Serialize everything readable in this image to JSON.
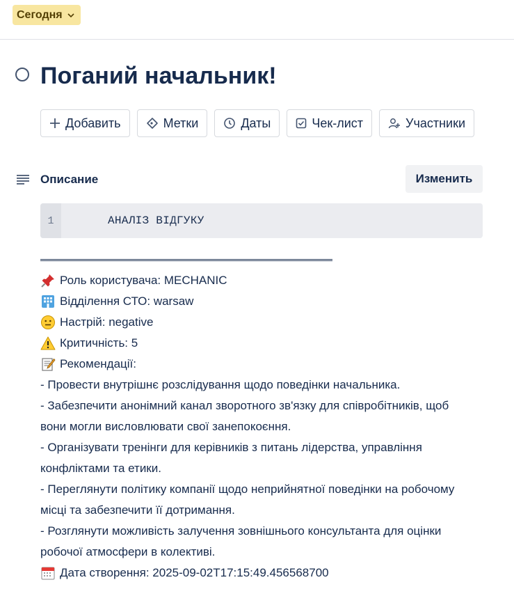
{
  "header": {
    "date_chip": "Сегодня"
  },
  "card": {
    "title": "Поганий начальник!"
  },
  "actions": [
    {
      "label": "Добавить",
      "icon": "plus-icon"
    },
    {
      "label": "Метки",
      "icon": "tag-icon"
    },
    {
      "label": "Даты",
      "icon": "clock-icon"
    },
    {
      "label": "Чек-лист",
      "icon": "checkbox-icon"
    },
    {
      "label": "Участники",
      "icon": "add-member-icon"
    }
  ],
  "description": {
    "label": "Описание",
    "edit_label": "Изменить",
    "code": {
      "line_number": "1",
      "text": "АНАЛІЗ ВІДГУКУ"
    },
    "lines": {
      "role": "Роль користувача: MECHANIC",
      "branch": "Відділення СТО: warsaw",
      "mood": "Настрій: negative",
      "criticality": "Критичність: 5",
      "recommendations": "Рекомендації:",
      "r1": "- Провести внутрішнє розслідування щодо поведінки начальника.",
      "r2a": "- Забезпечити анонімний канал зворотного зв'язку для співробітників, щоб",
      "r2b": "вони могли висловлювати свої занепокоєння.",
      "r3a": "- Організувати тренінги для керівників з питань лідерства, управління",
      "r3b": "конфліктами та етики.",
      "r4a": "- Переглянути політику компанії щодо неприйнятної поведінки на робочому",
      "r4b": "місці та забезпечити її дотримання.",
      "r5a": "- Розглянути можливість залучення зовнішнього консультанта для оцінки",
      "r5b": "робочої атмосфери в колективі.",
      "created": "Дата створення: 2025-09-02T17:15:49.456568700"
    }
  },
  "colors": {
    "chip_bg": "#f8e6a0",
    "chip_text": "#533f04",
    "text": "#172b4d",
    "code_bg": "#ebecf0"
  }
}
